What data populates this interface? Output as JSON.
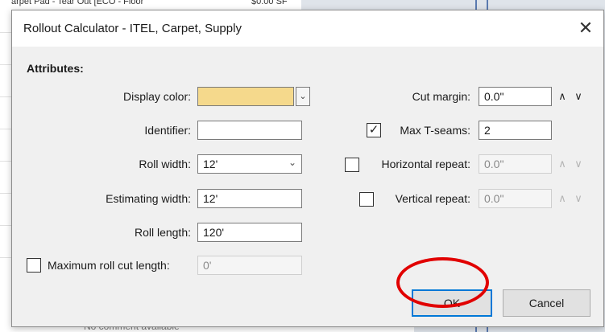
{
  "background": {
    "top_row_text": "arpet Pad - Tear Out [ECO - Floor",
    "top_row_price": "$0.00 SF",
    "bottom_text": "No comment available"
  },
  "dialog": {
    "title": "Rollout Calculator - ITEL, Carpet, Supply",
    "close_glyph": "✕"
  },
  "attributes": {
    "section_label": "Attributes:",
    "display_color": {
      "label": "Display color:",
      "value": "#f5d98c"
    },
    "identifier": {
      "label": "Identifier:",
      "value": ""
    },
    "roll_width": {
      "label": "Roll width:",
      "value": "12'"
    },
    "estimating_width": {
      "label": "Estimating width:",
      "value": "12'"
    },
    "roll_length": {
      "label": "Roll length:",
      "value": "120'"
    },
    "max_roll_cut": {
      "label": "Maximum roll cut length:",
      "value": "0'",
      "checked": false
    },
    "cut_margin": {
      "label": "Cut margin:",
      "value": "0.0\""
    },
    "max_t_seams": {
      "label": "Max T-seams:",
      "value": "2",
      "checked": true
    },
    "horizontal_repeat": {
      "label": "Horizontal repeat:",
      "value": "0.0\"",
      "checked": false
    },
    "vertical_repeat": {
      "label": "Vertical repeat:",
      "value": "0.0\"",
      "checked": false
    }
  },
  "buttons": {
    "ok": "OK",
    "cancel": "Cancel"
  },
  "icons": {
    "up": "∧",
    "down": "∨",
    "check": "✓",
    "dropdown": "⌄"
  },
  "colors": {
    "annotation_ring": "#e10000",
    "default_button_border": "#0078d7"
  }
}
